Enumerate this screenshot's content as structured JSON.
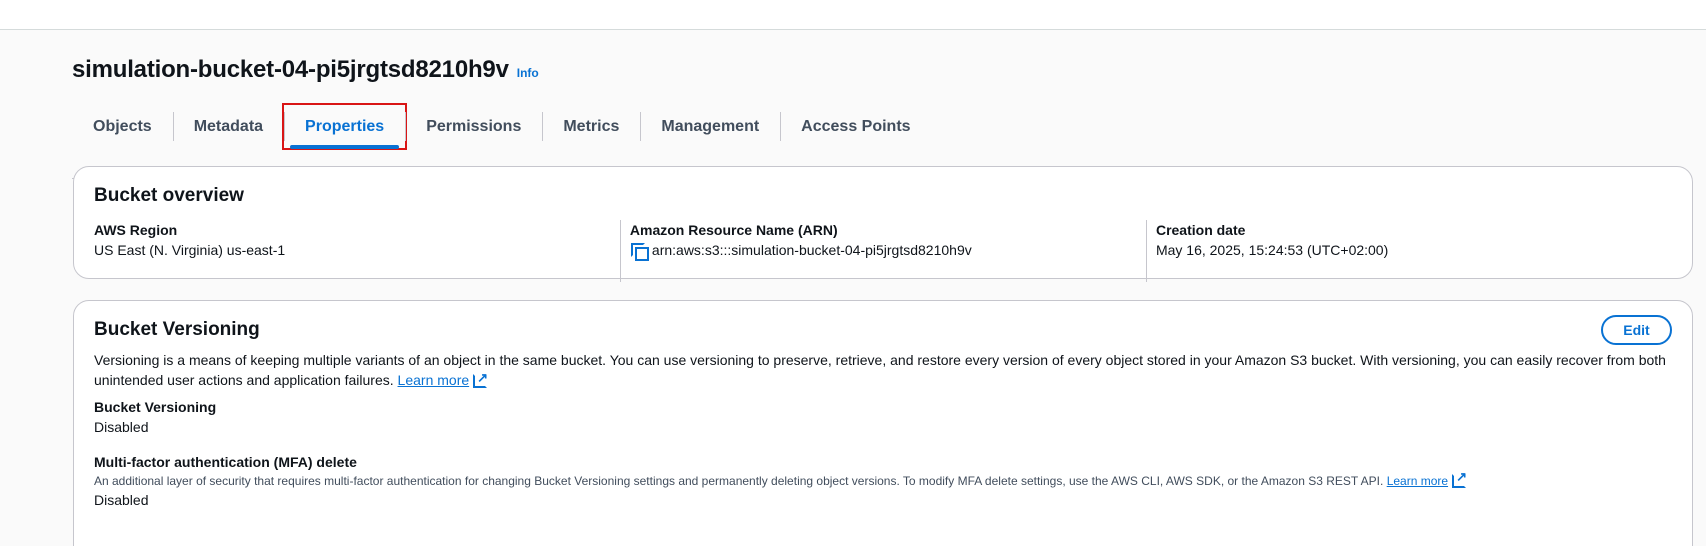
{
  "header": {
    "bucket_name": "simulation-bucket-04-pi5jrgtsd8210h9v",
    "info_label": "Info"
  },
  "tabs": [
    {
      "label": "Objects"
    },
    {
      "label": "Metadata"
    },
    {
      "label": "Properties",
      "active": true
    },
    {
      "label": "Permissions"
    },
    {
      "label": "Metrics"
    },
    {
      "label": "Management"
    },
    {
      "label": "Access Points"
    }
  ],
  "overview": {
    "title": "Bucket overview",
    "region_label": "AWS Region",
    "region_value": "US East (N. Virginia) us-east-1",
    "arn_label": "Amazon Resource Name (ARN)",
    "arn_value": "arn:aws:s3:::simulation-bucket-04-pi5jrgtsd8210h9v",
    "creation_label": "Creation date",
    "creation_value": "May 16, 2025, 15:24:53 (UTC+02:00)"
  },
  "versioning": {
    "title": "Bucket Versioning",
    "edit_label": "Edit",
    "description": "Versioning is a means of keeping multiple variants of an object in the same bucket. You can use versioning to preserve, retrieve, and restore every version of every object stored in your Amazon S3 bucket. With versioning, you can easily recover from both unintended user actions and application failures.",
    "learn_more": "Learn more",
    "status_label": "Bucket Versioning",
    "status_value": "Disabled",
    "mfa_label": "Multi-factor authentication (MFA) delete",
    "mfa_description": "An additional layer of security that requires multi-factor authentication for changing Bucket Versioning settings and permanently deleting object versions. To modify MFA delete settings, use the AWS CLI, AWS SDK, or the Amazon S3 REST API.",
    "mfa_learn_more": "Learn more",
    "mfa_value": "Disabled"
  },
  "colors": {
    "accent": "#0972d3",
    "highlight": "#d91515"
  }
}
